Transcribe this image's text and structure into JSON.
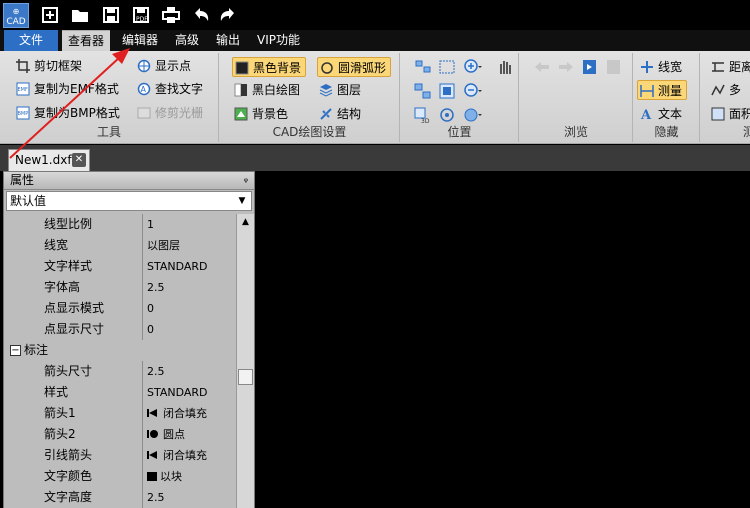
{
  "app": {
    "icon_label": "CAD"
  },
  "quick_access": [
    "new-file-icon",
    "open-folder-icon",
    "save-icon",
    "save-as-icon",
    "print-icon",
    "undo-icon",
    "redo-icon"
  ],
  "tabs": {
    "file": "文件",
    "items": [
      "查看器",
      "编辑器",
      "高级",
      "输出",
      "VIP功能"
    ],
    "active": "查看器"
  },
  "ribbon": {
    "tools": {
      "label": "工具",
      "buttons": [
        "剪切框架",
        "复制为EMF格式",
        "复制为BMP格式",
        "显示点",
        "查找文字",
        "修剪光栅"
      ]
    },
    "cad_settings": {
      "label": "CAD绘图设置",
      "buttons": [
        "黑色背景",
        "黑白绘图",
        "背景色",
        "圆滑弧形",
        "图层",
        "结构"
      ]
    },
    "position": {
      "label": "位置"
    },
    "browse": {
      "label": "浏览"
    },
    "hide": {
      "label": "隐藏",
      "buttons": [
        "线宽",
        "测量",
        "文本"
      ]
    },
    "measure": {
      "label": "测",
      "buttons": [
        "距离",
        "多",
        "面积"
      ]
    }
  },
  "document": {
    "tab_label": "New1.dxf",
    "close": "✕"
  },
  "panel": {
    "title": "属性",
    "pin": "ᵠ",
    "dropdown_value": "默认值",
    "rows": [
      {
        "key": "线型比例",
        "value": "1"
      },
      {
        "key": "线宽",
        "value": "以图层"
      },
      {
        "key": "文字样式",
        "value": "STANDARD"
      },
      {
        "key": "字体高",
        "value": "2.5"
      },
      {
        "key": "点显示模式",
        "value": "0"
      },
      {
        "key": "点显示尺寸",
        "value": "0"
      }
    ],
    "section": {
      "label": "标注",
      "expander": "−"
    },
    "section_rows": [
      {
        "key": "箭头尺寸",
        "value": "2.5"
      },
      {
        "key": "样式",
        "value": "STANDARD"
      },
      {
        "key": "箭头1",
        "value": "闭合填充",
        "icon": "filled-arrow-icon"
      },
      {
        "key": "箭头2",
        "value": "圆点",
        "icon": "dot-arrow-icon"
      },
      {
        "key": "引线箭头",
        "value": "闭合填充",
        "icon": "filled-arrow-icon"
      },
      {
        "key": "文字颜色",
        "value": "以块",
        "icon": "color-swatch-icon"
      },
      {
        "key": "文字高度",
        "value": "2.5"
      }
    ]
  },
  "colors": {
    "accent": "#2d6fc4",
    "highlight": "#fbd778",
    "annotation_arrow": "#e02020"
  }
}
